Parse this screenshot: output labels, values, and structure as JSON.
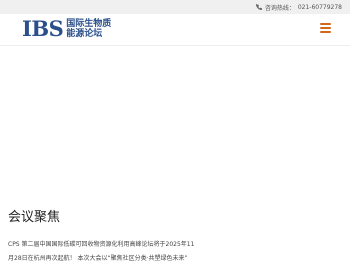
{
  "topbar": {
    "hotline_label": "咨询热线：",
    "hotline_number": "021-60779278"
  },
  "logo": {
    "mark": "IBS",
    "line1": "国际生物质",
    "line2": "能源论坛"
  },
  "section": {
    "title": "会议聚焦"
  },
  "news": {
    "line1": "CPS 第二届中国国际低碳可回收物资源化利用高峰论坛将于2025年11",
    "line2": "月28日在杭州再次起航！ 本次大会以“聚焦社区分类·共塑绿色未来”"
  },
  "colors": {
    "brand_blue": "#2a4f8a",
    "menu_orange": "#d0681c"
  },
  "icons": {
    "phone": "phone-icon",
    "menu": "hamburger-icon"
  }
}
